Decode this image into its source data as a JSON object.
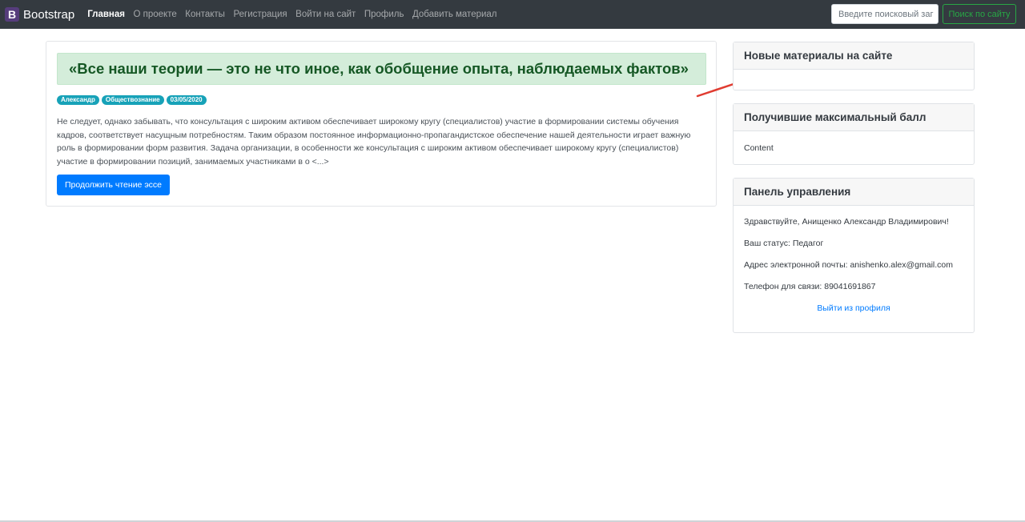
{
  "navbar": {
    "brand_letter": "B",
    "brand_name": "Bootstrap",
    "links": [
      "Главная",
      "О проекте",
      "Контакты",
      "Регистрация",
      "Войти на сайт",
      "Профиль",
      "Добавить материал"
    ],
    "search_placeholder": "Введите поисковый заг",
    "search_button": "Поиск по сайту"
  },
  "article": {
    "quote": "«Все наши теории — это не что иное, как обобщение опыта, наблюдаемых фактов»",
    "badges": [
      "Александр",
      "Обществознание",
      "03/05/2020"
    ],
    "text": "Не следует, однако забывать, что консультация с широким активом обеспечивает широкому кругу (специалистов) участие в формировании системы обучения кадров, соответствует насущным потребностям. Таким образом постоянное информационно-пропагандистское обеспечение нашей деятельности играет важную роль в формировании форм развития. Задача организации, в особенности же консультация с широким активом обеспечивает широкому кругу (специалистов) участие в формировании позиций, занимаемых участниками в о <...>",
    "read_button": "Продолжить чтение эссе"
  },
  "sidebar": {
    "new_materials": {
      "title": "Новые материалы на сайте"
    },
    "top_scores": {
      "title": "Получившие максимальный балл",
      "content": "Content"
    },
    "control_panel": {
      "title": "Панель управления",
      "greeting": "Здравствуйте, Анищенко Александр Владимирович!",
      "status": "Ваш статус: Педагог",
      "email": "Адрес электронной почты: anishenko.alex@gmail.com",
      "phone": "Телефон для связи: 89041691867",
      "logout": "Выйти из профиля"
    }
  },
  "colors": {
    "navbar_bg": "#343a40",
    "quote_bg": "#d4edda",
    "quote_text": "#155724",
    "badge": "#17a2b8",
    "primary": "#007bff",
    "success": "#28a745",
    "arrow": "#e03c31"
  },
  "annotation": {
    "icon": "red-arrow-icon"
  }
}
